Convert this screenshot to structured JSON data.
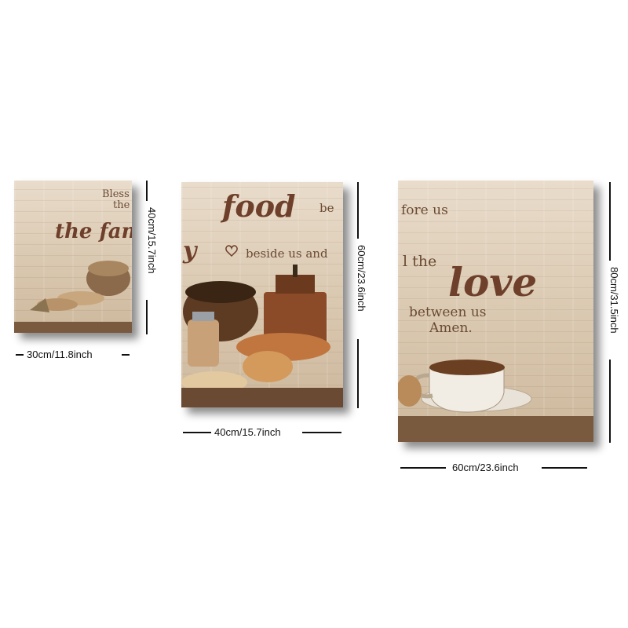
{
  "panels": {
    "small": {
      "line1": "Bless",
      "line2": "the",
      "script": "the family"
    },
    "medium": {
      "script_food": "food",
      "fragment_be": "be",
      "script_y": "y",
      "line": "beside us and"
    },
    "large": {
      "line1": "fore us",
      "line2": "l the",
      "script_love": "love",
      "line3": "between us",
      "line4": "Amen."
    }
  },
  "dimensions": {
    "small_width": "30cm/11.8inch",
    "small_height": "40cm/15.7inch",
    "medium_width": "40cm/15.7inch",
    "medium_height": "60cm/23.6inch",
    "large_width": "60cm/23.6inch",
    "large_height": "80cm/31.5inch"
  },
  "colors": {
    "text_brown": "#6e3f2a",
    "wood_light": "#e9dccb",
    "line": "#111111"
  }
}
